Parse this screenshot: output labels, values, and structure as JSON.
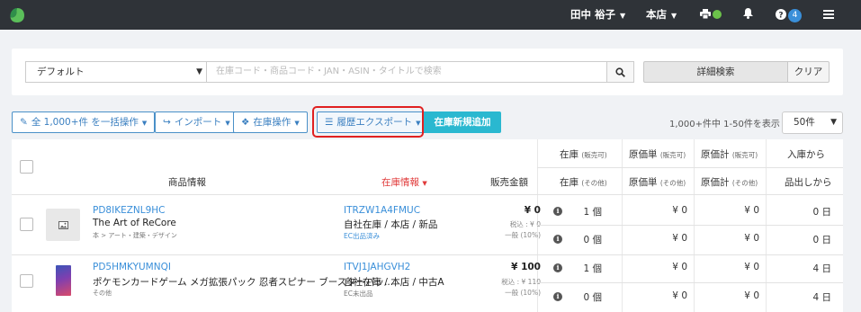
{
  "topbar": {
    "user_name": "田中 裕子",
    "store": "本店",
    "help_badge_count": "4"
  },
  "search": {
    "scope_value": "デフォルト",
    "placeholder": "在庫コード・商品コード・JAN・ASIN・タイトルで検索",
    "detail_label": "詳細検索",
    "clear_label": "クリア"
  },
  "actions": {
    "bulk_label": "全 1,000+件 を一括操作",
    "import_label": "インポート",
    "stock_op_label": "在庫操作",
    "history_export_label": "履歴エクスポート",
    "new_stock_label": "在庫新規追加",
    "count_text": "1,000+件中 1-50件を表示",
    "per_page": "50件"
  },
  "table": {
    "headers": {
      "product_info": "商品情報",
      "stock_info": "在庫情報",
      "sale_price": "販売金額",
      "stock": "在庫",
      "stock_sellable": "(販売可)",
      "stock_other": "(その他)",
      "unit_cost": "原価単",
      "unit_cost_sellable": "(販売可)",
      "unit_cost_other": "(その他)",
      "total_cost": "原価計",
      "total_cost_sellable": "(販売可)",
      "total_cost_other": "(その他)",
      "since_arrival": "入庫から",
      "since_listing": "品出しから"
    },
    "rows": [
      {
        "code": "PD8IKEZNL9HC",
        "name": "The Art of ReCore",
        "category": "本 > アート・建築・デザイン",
        "stock_code": "ITRZW1A4FMUC",
        "location": "自社在庫 / 本店 / 新品",
        "ec": "EC出品済み",
        "price": "¥ 0",
        "tax_price": "税込 : ¥ 0",
        "tax_rate": "一般 (10%)",
        "lines": [
          {
            "qty": "1 個",
            "unit": "¥ 0",
            "total": "¥ 0",
            "days": "0 日"
          },
          {
            "qty": "0 個",
            "unit": "¥ 0",
            "total": "¥ 0",
            "days": "0 日"
          }
        ]
      },
      {
        "code": "PD5HMKYUMNQI",
        "name": "ポケモンカードゲーム メガ拡張パック 忍者スピナー ブースターパッ...",
        "category": "その他",
        "stock_code": "ITVJ1JAHGVH2",
        "location": "自社在庫 / 本店 / 中古A",
        "ec": "EC未出品",
        "price": "¥ 100",
        "tax_price": "税込 : ¥ 110",
        "tax_rate": "一般 (10%)",
        "lines": [
          {
            "qty": "1 個",
            "unit": "¥ 0",
            "total": "¥ 0",
            "days": "4 日"
          },
          {
            "qty": "0 個",
            "unit": "¥ 0",
            "total": "¥ 0",
            "days": "4 日"
          }
        ]
      }
    ]
  },
  "colors": {
    "topbar": "#2f3338",
    "accent": "#3a8fd9",
    "new_button": "#2ab8d0",
    "highlight": "#e02020",
    "sort_active": "#e03a3a"
  }
}
